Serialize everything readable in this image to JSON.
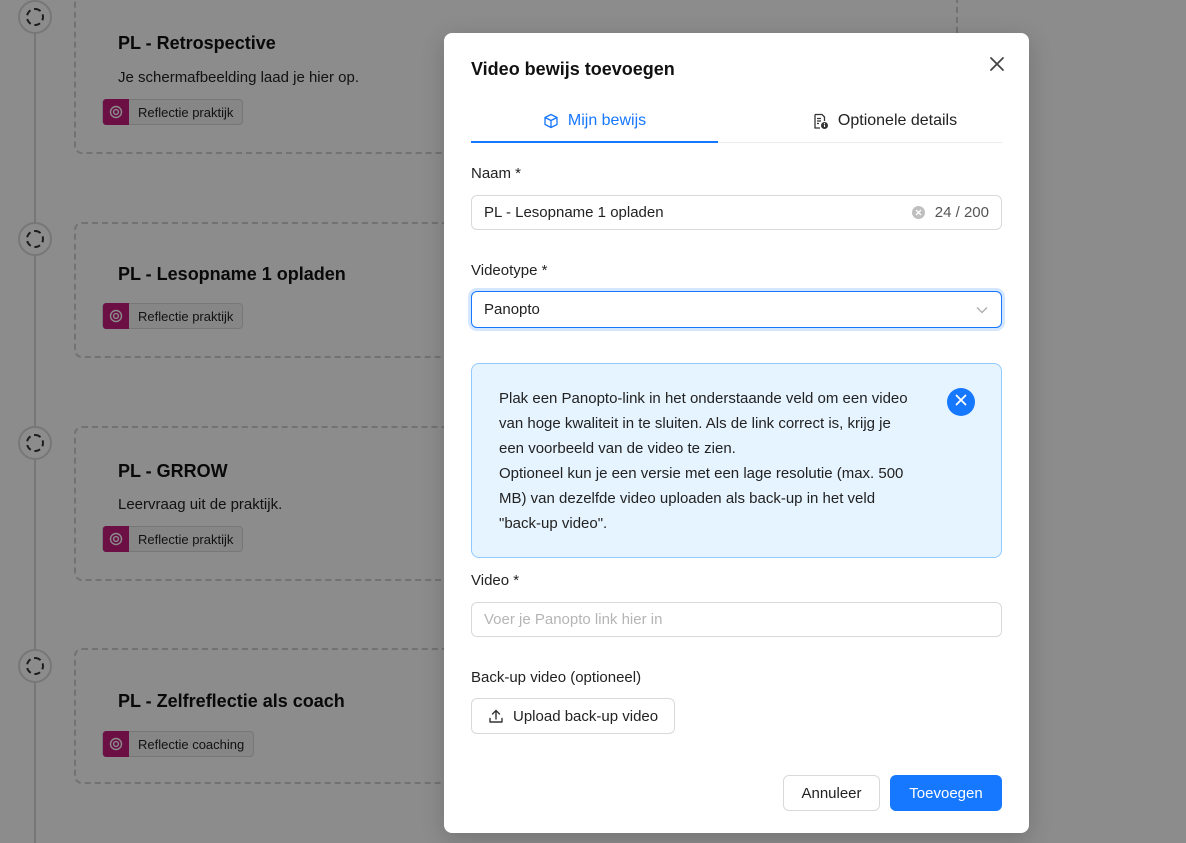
{
  "background": {
    "cards": [
      {
        "title": "PL - Retrospective",
        "description": "Je schermafbeelding laad je hier op.",
        "tag": "Reflectie praktijk"
      },
      {
        "title": "PL - Lesopname 1 opladen",
        "description": "",
        "tag": "Reflectie praktijk"
      },
      {
        "title": "PL - GRROW",
        "description": "Leervraag uit de praktijk.",
        "tag": "Reflectie praktijk"
      },
      {
        "title": "PL - Zelfreflectie als coach",
        "description": "",
        "tag": "Reflectie coaching"
      }
    ]
  },
  "modal": {
    "title": "Video bewijs toevoegen",
    "tabs": [
      {
        "label": "Mijn bewijs",
        "icon": "cube-icon",
        "active": true
      },
      {
        "label": "Optionele details",
        "icon": "document-info-icon",
        "active": false
      }
    ],
    "name_field": {
      "label": "Naam *",
      "value": "PL - Lesopname 1 opladen",
      "count": "24 / 200"
    },
    "videotype_field": {
      "label": "Videotype *",
      "value": "Panopto"
    },
    "info_alert": {
      "lines": [
        "Plak een Panopto-link in het onderstaande veld om een video",
        "van hoge kwaliteit in te sluiten. Als de link correct is, krijg je",
        "een voorbeeld van de video te zien.",
        "Optioneel kun je een versie met een lage resolutie (max. 500",
        "MB) van dezelfde video uploaden als back-up in het veld",
        "\"back-up video\"."
      ]
    },
    "video_field": {
      "label": "Video *",
      "placeholder": "Voer je Panopto link hier in"
    },
    "backup_field": {
      "label": "Back-up video (optioneel)",
      "button_label": "Upload back-up video"
    },
    "footer": {
      "cancel_label": "Annuleer",
      "submit_label": "Toevoegen"
    }
  },
  "colors": {
    "primary": "#1677ff",
    "tag_accent": "#c41d7f",
    "alert_bg": "#e6f4ff",
    "alert_border": "#91caff"
  }
}
